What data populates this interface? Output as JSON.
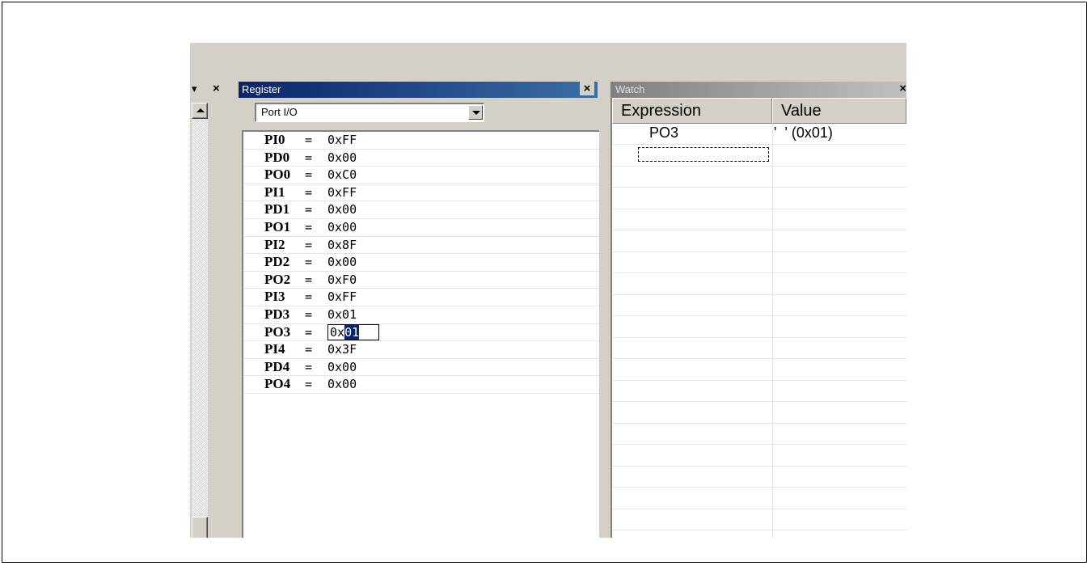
{
  "left_panel": {
    "header_icons": [
      "chevron-down-icon",
      "close-icon"
    ]
  },
  "register_panel": {
    "title": "Register",
    "close_glyph": "×",
    "category": "Port I/O",
    "rows": [
      {
        "name": "PI0",
        "value": "0xFF"
      },
      {
        "name": "PD0",
        "value": "0x00"
      },
      {
        "name": "PO0",
        "value": "0xC0"
      },
      {
        "name": "PI1",
        "value": "0xFF"
      },
      {
        "name": "PD1",
        "value": "0x00"
      },
      {
        "name": "PO1",
        "value": "0x00"
      },
      {
        "name": "PI2",
        "value": "0x8F"
      },
      {
        "name": "PD2",
        "value": "0x00"
      },
      {
        "name": "PO2",
        "value": "0xF0"
      },
      {
        "name": "PI3",
        "value": "0xFF"
      },
      {
        "name": "PD3",
        "value": "0x01"
      },
      {
        "name": "PO3",
        "value": "0x01",
        "editing": true,
        "edit_prefix": "0x",
        "edit_selected": "01"
      },
      {
        "name": "PI4",
        "value": "0x3F"
      },
      {
        "name": "PD4",
        "value": "0x00"
      },
      {
        "name": "PO4",
        "value": "0x00"
      }
    ]
  },
  "watch_panel": {
    "title": "Watch",
    "close_glyph": "×",
    "columns": [
      "Expression",
      "Value"
    ],
    "rows": [
      {
        "expression": "PO3",
        "value": "'  ' (0x01)"
      }
    ]
  },
  "colors": {
    "active_title": "#0a246a",
    "inactive_title": "#808080",
    "window_bg": "#d4d0c8",
    "selection": "#0a246a"
  }
}
